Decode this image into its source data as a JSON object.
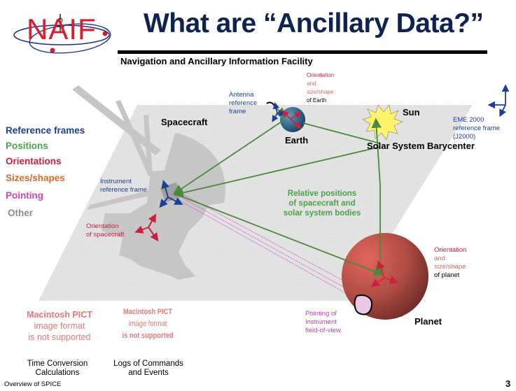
{
  "header": {
    "logo_text": "NAIF",
    "title": "What are “Ancillary Data?”",
    "subtitle": "Navigation and Ancillary Information Facility"
  },
  "categories": [
    {
      "label": "Reference frames",
      "color": "#1d3f94"
    },
    {
      "label": "Positions",
      "color": "#4aa24a"
    },
    {
      "label": "Orientations",
      "color": "#cc1f3d"
    },
    {
      "label": "Sizes/shapes",
      "color": "#dd6a2c"
    },
    {
      "label": "Pointing",
      "color": "#d63fb6"
    },
    {
      "label": "Other",
      "color": "#8c8c8c"
    }
  ],
  "diagram": {
    "spacecraft_label": "Spacecraft",
    "earth_label": "Earth",
    "sun_label": "Sun",
    "barycenter_label": "Solar System Barycenter",
    "planet_label": "Planet",
    "antenna_frame": [
      "Antenna",
      "reference",
      "frame"
    ],
    "earth_orientation": {
      "line1": "Orientation",
      "line2": "and",
      "line3": "size/shape",
      "line4": "of Earth"
    },
    "eme_frame": [
      "EME 2000",
      "reference frame",
      "(J2000)"
    ],
    "instrument_frame": [
      "Instrument",
      "reference frame"
    ],
    "relative_positions": [
      "Relative positions",
      "of spacecraft and",
      "solar system bodies"
    ],
    "spacecraft_orientation": [
      "Orientation",
      "of spacecraft"
    ],
    "planet_orientation": {
      "line1": "Orientation",
      "line2": "and",
      "line3": "size/shape",
      "line4": "of planet"
    },
    "pointing_fov": [
      "Pointing of",
      "Instrument",
      "field-of-view"
    ]
  },
  "placeholders": [
    {
      "lines": [
        "Macintosh PICT",
        "image format",
        "is not supported"
      ],
      "caption": [
        "Time Conversion",
        "Calculations"
      ]
    },
    {
      "lines": [
        "Macintosh PICT",
        "image format",
        "is not supported"
      ],
      "caption": [
        "Logs of Commands",
        "and Events"
      ]
    }
  ],
  "footer": {
    "left": "Overview of SPICE",
    "page_number": "3"
  },
  "colors": {
    "title": "#0f2350",
    "frame_blue": "#1d3f94",
    "position_green": "#4b8a3c",
    "orientation_red": "#cc1f3d",
    "shape_tan": "#c8716a",
    "pointing_magenta": "#c13fb0",
    "planet": "#a94a42",
    "sun": "#fff36a"
  }
}
